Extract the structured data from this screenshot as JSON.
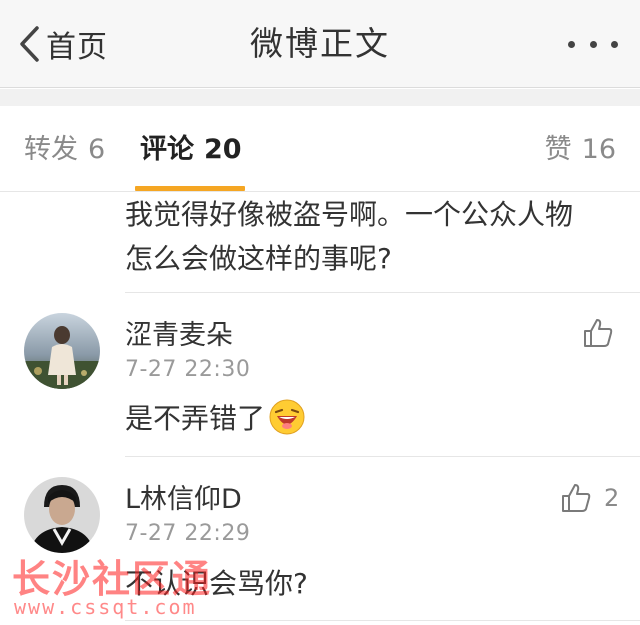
{
  "navbar": {
    "back_label": "首页",
    "title": "微博正文"
  },
  "tabs": {
    "repost": {
      "label": "转发",
      "count": "6"
    },
    "comment": {
      "label": "评论",
      "count": "20"
    },
    "like": {
      "label": "赞",
      "count": "16"
    }
  },
  "comments": [
    {
      "text_lines": [
        "我觉得好像被盗号啊。一个公众人物",
        "怎么会做这样的事呢?"
      ]
    },
    {
      "user": "涩青麦朵",
      "time": "7-27 22:30",
      "text": "是不弄错了",
      "emoji": "laughing-emoji",
      "likes": ""
    },
    {
      "user": "L林信仰D",
      "time": "7-27 22:29",
      "text": "不认识会骂你?",
      "likes": "2"
    }
  ],
  "watermark": {
    "logo": "长沙社区通",
    "url": "www.cssqt.com"
  },
  "colors": {
    "accent_underline": "#f5a623",
    "watermark_red": "#ff1f1f",
    "navbar_bg": "#f7f7f7"
  }
}
